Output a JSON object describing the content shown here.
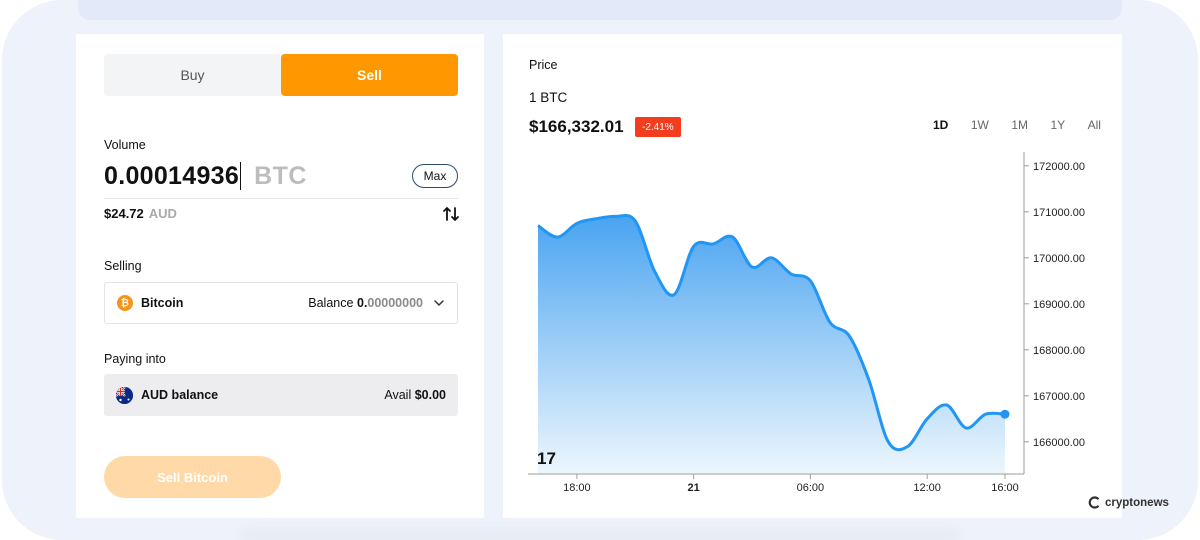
{
  "trade": {
    "tabs": [
      {
        "label": "Buy",
        "active": false
      },
      {
        "label": "Sell",
        "active": true
      }
    ],
    "volume": {
      "label": "Volume",
      "amount": "0.00014936",
      "unit": "BTC",
      "max_label": "Max",
      "fiat_amount": "$24.72",
      "fiat_unit": "AUD"
    },
    "selling": {
      "label": "Selling",
      "asset": "Bitcoin",
      "coin_symbol": "₿",
      "balance_label": "Balance",
      "balance_int": "0.",
      "balance_frac": "00000000"
    },
    "paying": {
      "label": "Paying into",
      "account": "AUD balance",
      "avail_label": "Avail",
      "avail_amount": "$0.00"
    },
    "submit_label": "Sell Bitcoin"
  },
  "price": {
    "title": "Price",
    "unit": "1 BTC",
    "value": "$166,332.01",
    "change": "-2.41%",
    "ranges": [
      "1D",
      "1W",
      "1M",
      "1Y",
      "All"
    ],
    "active_range": "1D"
  },
  "chart_data": {
    "type": "area",
    "x_ticks": [
      "18:00",
      "21",
      "06:00",
      "12:00",
      "16:00"
    ],
    "y_ticks": [
      "172000.00",
      "171000.00",
      "170000.00",
      "169000.00",
      "168000.00",
      "167000.00",
      "166000.00"
    ],
    "ylim": [
      165300,
      172300
    ],
    "x_unit_hours": "hours from 16:00 of previous day",
    "x": [
      0,
      1,
      2,
      3,
      4,
      5,
      6,
      7,
      8,
      9,
      10,
      11,
      12,
      13,
      14,
      15,
      16,
      17,
      18,
      19,
      20,
      21,
      22,
      23,
      24
    ],
    "values": [
      170700,
      170450,
      170750,
      170850,
      170900,
      170800,
      169700,
      169200,
      170250,
      170300,
      170450,
      169800,
      170000,
      169650,
      169500,
      168600,
      168300,
      167350,
      166000,
      165900,
      166500,
      166800,
      166300,
      166600,
      166600
    ],
    "series_color": "#2196f3",
    "logo_glyph": "17"
  },
  "branding": {
    "watermark": "cryptonews"
  }
}
